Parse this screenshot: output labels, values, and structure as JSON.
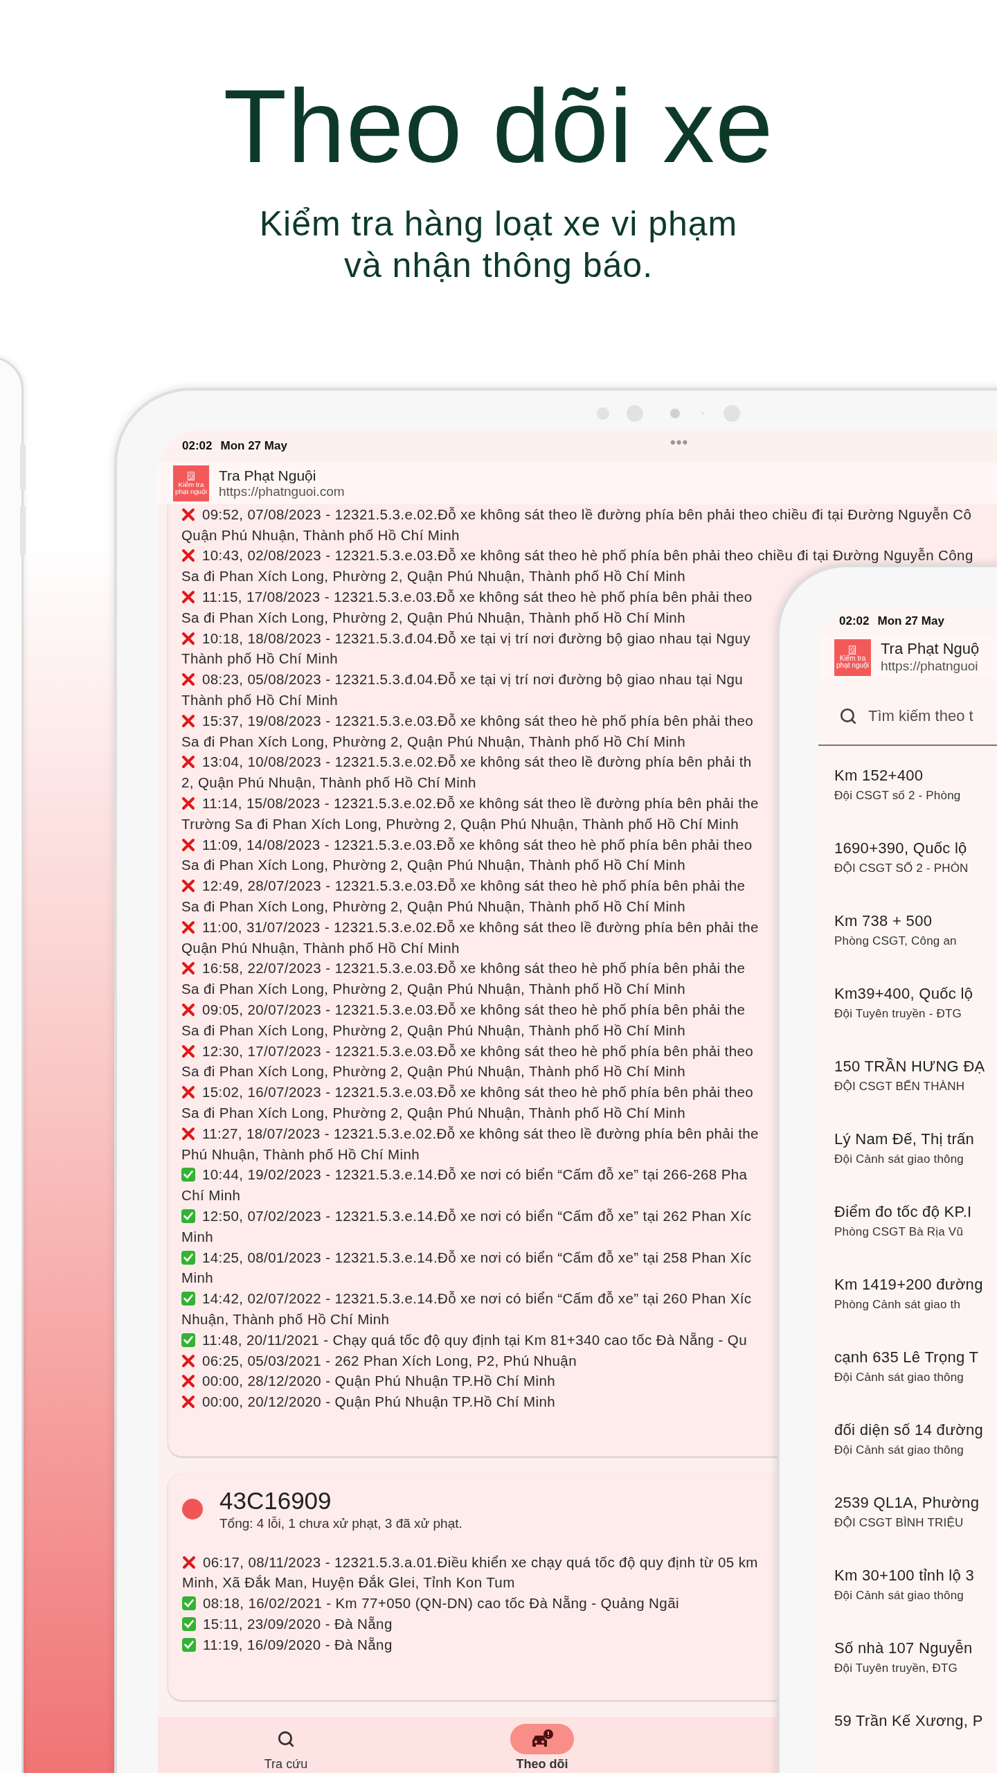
{
  "hero": {
    "title": "Theo dõi xe",
    "subtitle_lines": [
      "Kiểm tra hàng loạt xe vi phạm",
      "và nhận thông báo."
    ]
  },
  "tablet": {
    "status_time": "02:02",
    "status_date": "Mon 27 May",
    "more": "•••",
    "app": {
      "name": "Tra Phạt Nguội",
      "url": "https://phatnguoi.com",
      "logo_caption": [
        "Kiểm tra",
        "phạt nguội"
      ]
    },
    "cards": [
      {
        "entries": [
          {
            "paid": false,
            "lines": [
              "09:52, 07/08/2023 - 12321.5.3.e.02.Đỗ xe không sát theo lề đường phía bên phải theo chiều đi tại Đường Nguyễn Cô",
              "Quận Phú Nhuận, Thành phố Hồ Chí Minh"
            ]
          },
          {
            "paid": false,
            "lines": [
              "10:43, 02/08/2023 - 12321.5.3.e.03.Đỗ xe không sát theo hè phố phía bên phải theo chiều đi tại Đường Nguyễn Công",
              "Sa đi Phan Xích Long, Phường 2, Quận Phú Nhuận, Thành phố Hồ Chí Minh"
            ]
          },
          {
            "paid": false,
            "lines": [
              "11:15, 17/08/2023 - 12321.5.3.e.03.Đỗ xe không sát theo hè phố phía bên phải theo",
              "Sa đi Phan Xích Long, Phường 2, Quận Phú Nhuận, Thành phố Hồ Chí Minh"
            ]
          },
          {
            "paid": false,
            "lines": [
              "10:18, 18/08/2023 - 12321.5.3.đ.04.Đỗ xe tại vị trí nơi đường bộ giao nhau tại Nguy",
              "Thành phố Hồ Chí Minh"
            ]
          },
          {
            "paid": false,
            "lines": [
              "08:23, 05/08/2023 - 12321.5.3.đ.04.Đỗ xe tại vị trí nơi đường bộ giao nhau tại Ngu",
              "Thành phố Hồ Chí Minh"
            ]
          },
          {
            "paid": false,
            "lines": [
              "15:37, 19/08/2023 - 12321.5.3.e.03.Đỗ xe không sát theo hè phố phía bên phải theo",
              "Sa đi Phan Xích Long, Phường 2, Quận Phú Nhuận, Thành phố Hồ Chí Minh"
            ]
          },
          {
            "paid": false,
            "lines": [
              "13:04, 10/08/2023 - 12321.5.3.e.02.Đỗ xe không sát theo lề đường phía bên phải th",
              "2, Quận Phú Nhuận, Thành phố Hồ Chí Minh"
            ]
          },
          {
            "paid": false,
            "lines": [
              "11:14, 15/08/2023 - 12321.5.3.e.02.Đỗ xe không sát theo lề đường phía bên phải the",
              "Trường Sa đi Phan Xích Long, Phường 2, Quận Phú Nhuận, Thành phố Hồ Chí Minh"
            ]
          },
          {
            "paid": false,
            "lines": [
              "11:09, 14/08/2023 - 12321.5.3.e.03.Đỗ xe không sát theo hè phố phía bên phải theo",
              "Sa đi Phan Xích Long, Phường 2, Quận Phú Nhuận, Thành phố Hồ Chí Minh"
            ]
          },
          {
            "paid": false,
            "lines": [
              "12:49, 28/07/2023 - 12321.5.3.e.03.Đỗ xe không sát theo hè phố phía bên phải the",
              "Sa đi Phan Xích Long, Phường 2, Quận Phú Nhuận, Thành phố Hồ Chí Minh"
            ]
          },
          {
            "paid": false,
            "lines": [
              "11:00, 31/07/2023 - 12321.5.3.e.02.Đỗ xe không sát theo lề đường phía bên phải the",
              "Quận Phú Nhuận, Thành phố Hồ Chí Minh"
            ]
          },
          {
            "paid": false,
            "lines": [
              "16:58, 22/07/2023 - 12321.5.3.e.03.Đỗ xe không sát theo hè phố phía bên phải the",
              "Sa đi Phan Xích Long, Phường 2, Quận Phú Nhuận, Thành phố Hồ Chí Minh"
            ]
          },
          {
            "paid": false,
            "lines": [
              "09:05, 20/07/2023 - 12321.5.3.e.03.Đỗ xe không sát theo hè phố phía bên phải the",
              "Sa đi Phan Xích Long, Phường 2, Quận Phú Nhuận, Thành phố Hồ Chí Minh"
            ]
          },
          {
            "paid": false,
            "lines": [
              "12:30, 17/07/2023 - 12321.5.3.e.03.Đỗ xe không sát theo hè phố phía bên phải theo",
              "Sa đi Phan Xích Long, Phường 2, Quận Phú Nhuận, Thành phố Hồ Chí Minh"
            ]
          },
          {
            "paid": false,
            "lines": [
              "15:02, 16/07/2023 - 12321.5.3.e.03.Đỗ xe không sát theo hè phố phía bên phải theo",
              "Sa đi Phan Xích Long, Phường 2, Quận Phú Nhuận, Thành phố Hồ Chí Minh"
            ]
          },
          {
            "paid": false,
            "lines": [
              "11:27, 18/07/2023 - 12321.5.3.e.02.Đỗ xe không sát theo lề đường phía bên phải the",
              "Phú Nhuận, Thành phố Hồ Chí Minh"
            ]
          },
          {
            "paid": true,
            "lines": [
              "10:44, 19/02/2023 - 12321.5.3.e.14.Đỗ xe nơi có biển “Cấm đỗ xe” tại 266-268 Pha",
              "Chí Minh"
            ]
          },
          {
            "paid": true,
            "lines": [
              "12:50, 07/02/2023 - 12321.5.3.e.14.Đỗ xe nơi có biển “Cấm đỗ xe” tại 262 Phan Xíc",
              "Minh"
            ]
          },
          {
            "paid": true,
            "lines": [
              "14:25, 08/01/2023 - 12321.5.3.e.14.Đỗ xe nơi có biển “Cấm đỗ xe” tại 258 Phan Xíc",
              "Minh"
            ]
          },
          {
            "paid": true,
            "lines": [
              "14:42, 02/07/2022 - 12321.5.3.e.14.Đỗ xe nơi có biển “Cấm đỗ xe” tại 260 Phan Xíc",
              "Nhuận, Thành phố Hồ Chí Minh"
            ]
          },
          {
            "paid": true,
            "lines": [
              "11:48, 20/11/2021 - Chạy quá tốc độ quy định tại Km 81+340 cao tốc Đà Nẵng - Qu"
            ]
          },
          {
            "paid": false,
            "lines": [
              "06:25, 05/03/2021 - 262 Phan Xích Long, P2, Phú Nhuận"
            ]
          },
          {
            "paid": false,
            "lines": [
              "00:00, 28/12/2020 - Quận Phú Nhuận TP.Hồ Chí Minh"
            ]
          },
          {
            "paid": false,
            "lines": [
              "00:00, 20/12/2020 - Quận Phú Nhuận TP.Hồ Chí Minh"
            ]
          }
        ]
      },
      {
        "plate": "43C16909",
        "summary": "Tổng: 4 lỗi, 1 chưa xử phạt, 3 đã xử phạt.",
        "color": "#f25555",
        "entries": [
          {
            "paid": false,
            "lines": [
              "06:17, 08/11/2023 - 12321.5.3.a.01.Điều khiển xe chạy quá tốc độ quy định từ 05 km",
              "Minh, Xã Đắk Man, Huyện Đắk Glei, Tỉnh Kon Tum"
            ]
          },
          {
            "paid": true,
            "lines": [
              "08:18, 16/02/2021 - Km 77+050 (QN-DN) cao tốc Đà Nẵng - Quảng Ngãi"
            ]
          },
          {
            "paid": true,
            "lines": [
              "15:11, 23/09/2020 - Đà Nẵng"
            ]
          },
          {
            "paid": true,
            "lines": [
              "11:19, 16/09/2020 - Đà Nẵng"
            ]
          }
        ]
      }
    ],
    "nav": [
      {
        "kind": "search",
        "label": "Tra cứu",
        "selected": false
      },
      {
        "kind": "car",
        "label": "Theo dõi",
        "selected": true
      }
    ]
  },
  "phone": {
    "status_time": "02:02",
    "status_date": "Mon 27 May",
    "app": {
      "name": "Tra Phạt Nguộ",
      "url": "https://phatnguoi",
      "logo_caption": [
        "Kiểm tra",
        "phạt nguội"
      ]
    },
    "search": {
      "placeholder": "Tìm kiếm theo t"
    },
    "locations": [
      {
        "title": "Km 152+400",
        "subtitle": "Đội CSGT số 2 - Phòng"
      },
      {
        "title": "1690+390, Quốc lộ",
        "subtitle": "ĐỘI CSGT SỐ 2 - PHÒN"
      },
      {
        "title": "Km 738 + 500",
        "subtitle": "Phòng CSGT, Công an"
      },
      {
        "title": "Km39+400, Quốc lộ",
        "subtitle": "Đội Tuyên truyền - ĐTG"
      },
      {
        "title": "150 TRẦN HƯNG ĐẠ",
        "subtitle": "ĐỘI CSGT BẾN THÀNH"
      },
      {
        "title": "Lý Nam Đế, Thị trấn",
        "subtitle": "Đội Cảnh sát giao thông"
      },
      {
        "title": "Điểm đo tốc độ KP.I",
        "subtitle": "Phòng CSGT Bà Rịa Vũ"
      },
      {
        "title": "Km 1419+200 đường",
        "subtitle": "Phòng Cảnh sát giao th"
      },
      {
        "title": "cạnh 635 Lê Trọng T",
        "subtitle": "Đội Cảnh sát giao thông"
      },
      {
        "title": "đối diện số 14 đường",
        "subtitle": "Đội Cảnh sát giao thông"
      },
      {
        "title": "2539 QL1A, Phường",
        "subtitle": "ĐỘI CSGT BÌNH TRIỆU"
      },
      {
        "title": "Km 30+100 tỉnh lộ 3",
        "subtitle": "Đội Cảnh sát giao thông"
      },
      {
        "title": "Số nhà 107 Nguyễn",
        "subtitle": "Đội Tuyên truyền, ĐTG"
      },
      {
        "title": "59 Trần Kế Xương, P"
      }
    ]
  }
}
